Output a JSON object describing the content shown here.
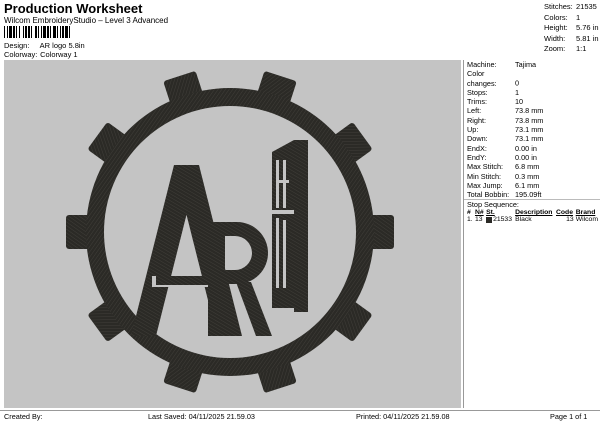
{
  "header": {
    "title": "Production Worksheet",
    "subtitle": "Wilcom EmbroideryStudio – Level 3 Advanced",
    "design_label": "Design:",
    "design_value": "AR logo 5.8in",
    "colorway_label": "Colorway:",
    "colorway_value": "Colorway 1"
  },
  "summary": [
    {
      "label": "Stitches:",
      "value": "21535"
    },
    {
      "label": "Colors:",
      "value": "1"
    },
    {
      "label": "Height:",
      "value": "5.76 in"
    },
    {
      "label": "Width:",
      "value": "5.81 in"
    },
    {
      "label": "Zoom:",
      "value": "1:1"
    }
  ],
  "machine_stats": [
    {
      "label": "Machine:",
      "value": "Tajima"
    },
    {
      "label": "Color changes:",
      "value": "0"
    },
    {
      "label": "Stops:",
      "value": "1"
    },
    {
      "label": "Trims:",
      "value": "10"
    },
    {
      "label": "Left:",
      "value": "73.8 mm"
    },
    {
      "label": "Right:",
      "value": "73.8 mm"
    },
    {
      "label": "Up:",
      "value": "73.1 mm"
    },
    {
      "label": "Down:",
      "value": "73.1 mm"
    },
    {
      "label": "EndX:",
      "value": "0.00 in"
    },
    {
      "label": "EndY:",
      "value": "0.00 in"
    },
    {
      "label": "Max Stitch:",
      "value": "6.8 mm"
    },
    {
      "label": "Min Stitch:",
      "value": "0.3 mm"
    },
    {
      "label": "Max Jump:",
      "value": "6.1 mm"
    },
    {
      "label": "Total Bobbin:",
      "value": "195.09ft"
    }
  ],
  "stop_sequence": {
    "title": "Stop Sequence:",
    "headers": [
      "#",
      "N#",
      "St.",
      "Description",
      "Code",
      "Brand"
    ],
    "rows": [
      {
        "index": "1.",
        "needle": "13",
        "stitches": "21533",
        "description": "Black",
        "code": "13",
        "brand": "Wilcom"
      }
    ]
  },
  "footer": {
    "created_by": "Created By:",
    "last_saved": "Last Saved: 04/11/2025 21.59.03",
    "printed": "Printed: 04/11/2025 21.59.08",
    "page": "Page 1 of 1"
  },
  "colors": {
    "thread": "#2b2a26",
    "canvas": "#c4c4c4"
  },
  "icons": {
    "swatch": "color-swatch-icon"
  }
}
